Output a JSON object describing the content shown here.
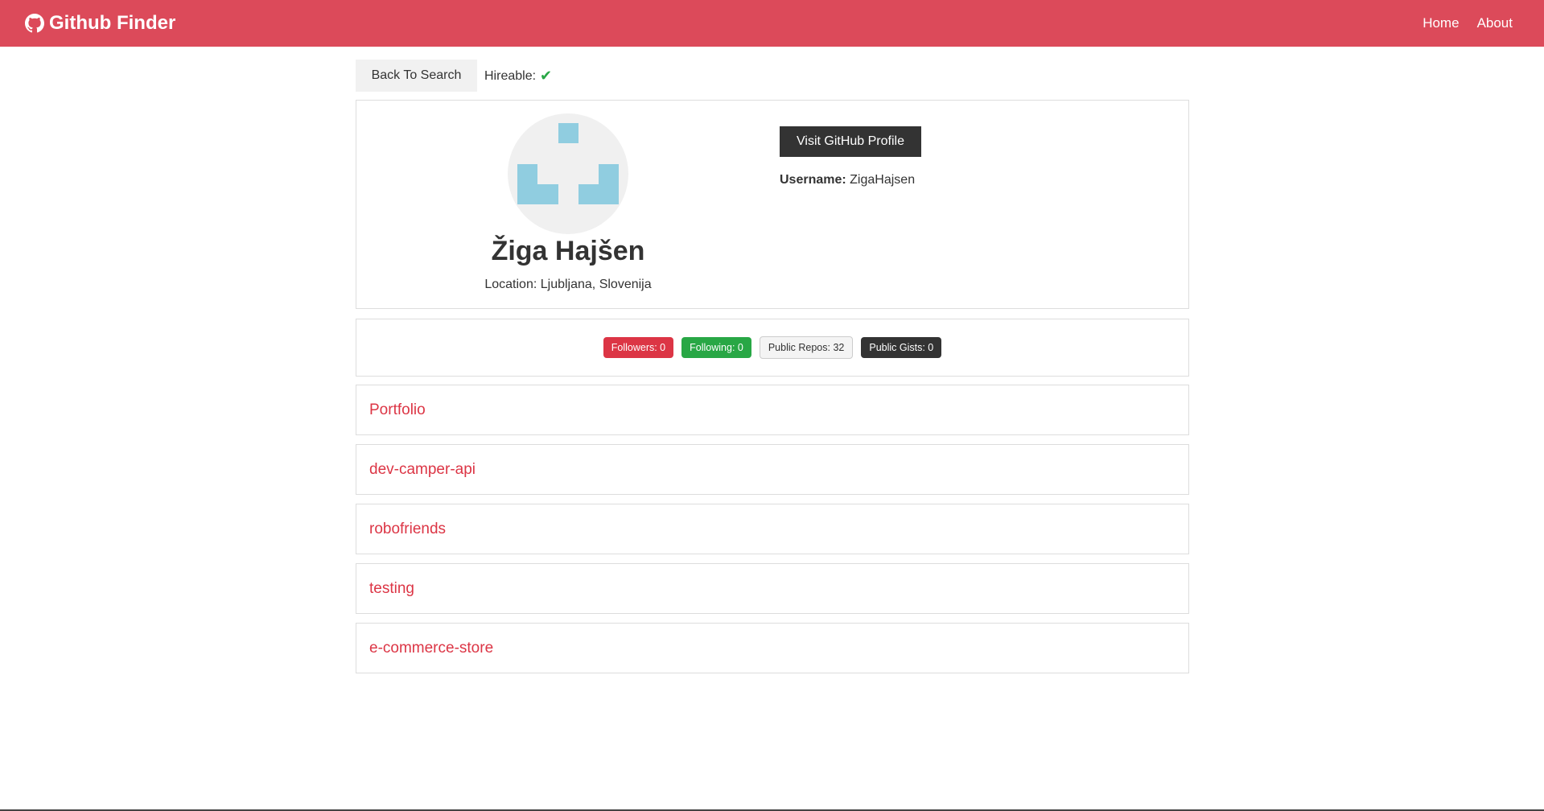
{
  "navbar": {
    "brand": "Github Finder",
    "links": [
      "Home",
      "About"
    ],
    "color": "#dc4a5a"
  },
  "actions": {
    "back_label": "Back To Search",
    "hireable_label": "Hireable:",
    "hireable_icon": "check-icon"
  },
  "profile": {
    "name": "Žiga Hajšen",
    "location": "Location: Ljubljana, Slovenija",
    "visit_label": "Visit GitHub Profile",
    "username_label": "Username:",
    "username_value": "ZigaHajsen"
  },
  "stats": {
    "followers": "Followers: 0",
    "following": "Following: 0",
    "repos": "Public Repos: 32",
    "gists": "Public Gists: 0"
  },
  "repos": [
    "Portfolio",
    "dev-camper-api",
    "robofriends",
    "testing",
    "e-commerce-store"
  ],
  "colors": {
    "primary": "#dc3545",
    "success": "#28a745",
    "dark": "#333333",
    "avatar_block": "#90cde0"
  }
}
